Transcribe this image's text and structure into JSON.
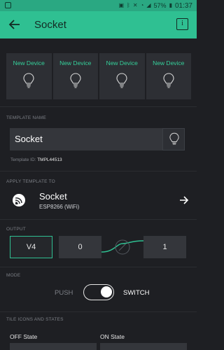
{
  "status_bar": {
    "battery": "57%",
    "time": "01:37"
  },
  "app_bar": {
    "title": "Socket",
    "info_label": "i"
  },
  "devices": [
    {
      "label": "New Device"
    },
    {
      "label": "New Device"
    },
    {
      "label": "New Device"
    },
    {
      "label": "New Device"
    }
  ],
  "template_name": {
    "section": "TEMPLATE NAME",
    "value": "Socket",
    "id_label": "Template ID:",
    "id_value": "TMPL44513"
  },
  "apply_template": {
    "section": "APPLY TEMPLATE TO",
    "device_name": "Socket",
    "board": "ESP8266 (WiFi)"
  },
  "output": {
    "section": "OUTPUT",
    "pin": "V4",
    "min": "0",
    "max": "1"
  },
  "mode": {
    "section": "MODE",
    "push_label": "PUSH",
    "switch_label": "SWITCH",
    "selected": "SWITCH"
  },
  "tile_icons": {
    "section": "TILE ICONS AND STATES",
    "off_label": "OFF State",
    "on_label": "ON State"
  },
  "colors": {
    "accent": "#2fc092",
    "background": "#1e1f23",
    "device_label": "#35d19b"
  }
}
